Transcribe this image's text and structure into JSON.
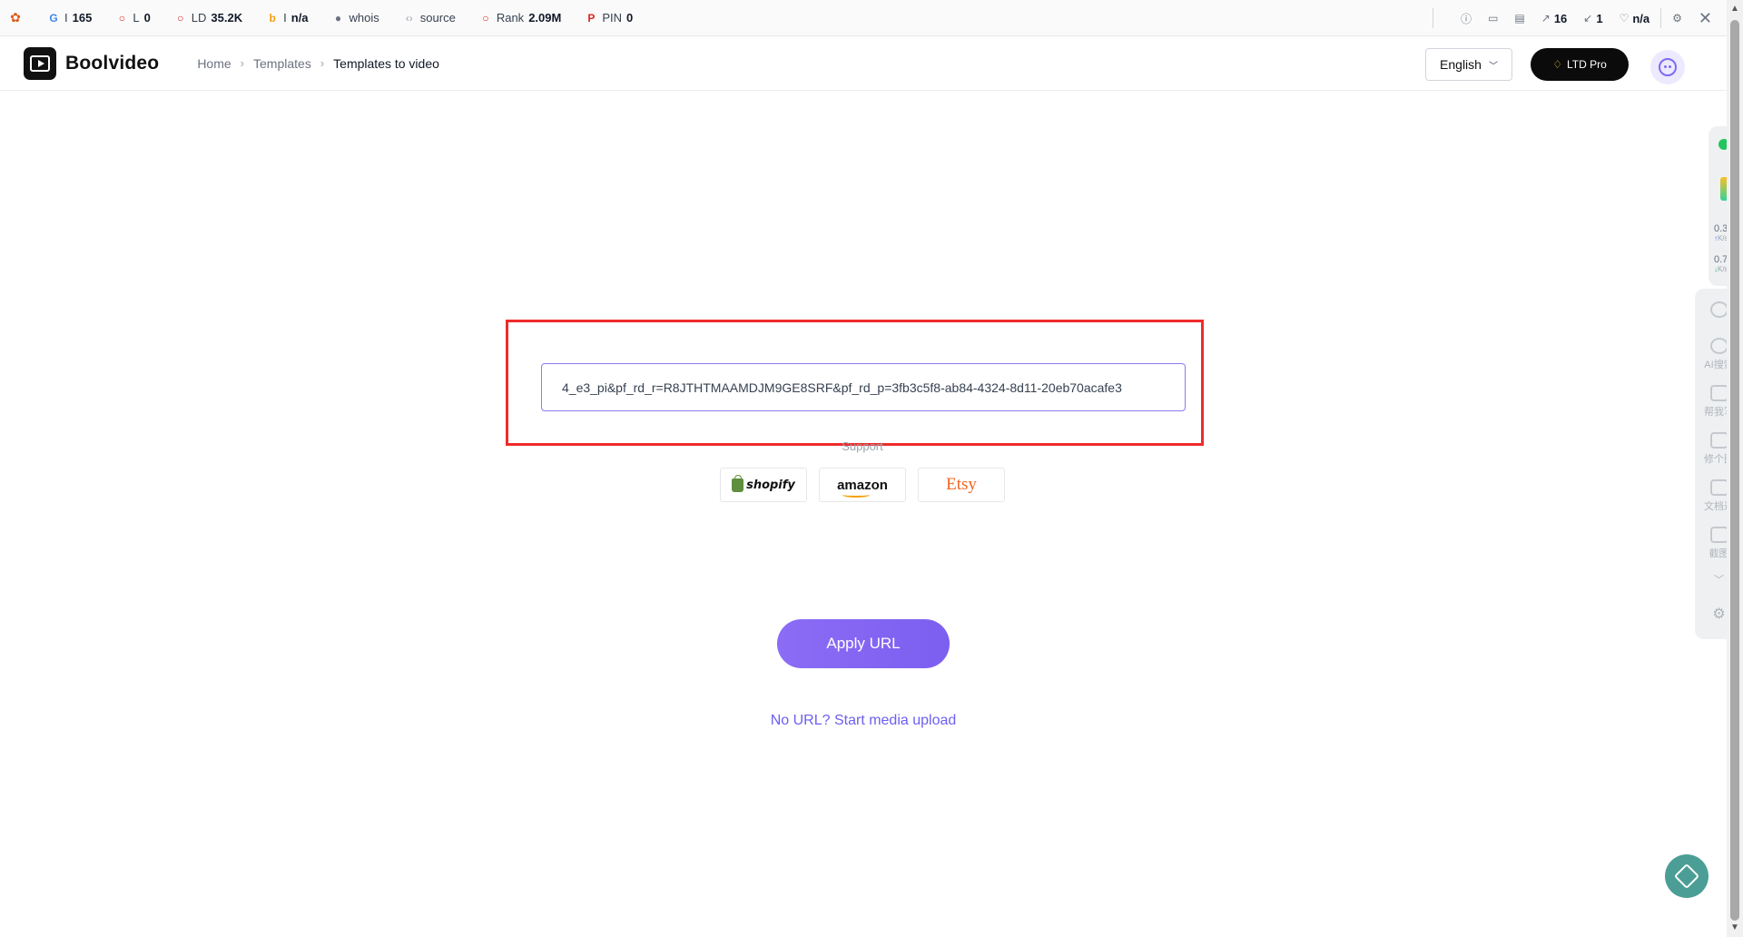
{
  "seo_toolbar": {
    "items": [
      {
        "icon": "google-icon",
        "prefix": "I",
        "value": "165"
      },
      {
        "icon": "circle-icon",
        "prefix": "L",
        "value": "0"
      },
      {
        "icon": "circle-icon",
        "prefix": "LD",
        "value": "35.2K"
      },
      {
        "icon": "bing-icon",
        "prefix": "I",
        "value": "n/a"
      },
      {
        "icon": "person-icon",
        "prefix": "whois",
        "value": ""
      },
      {
        "icon": "code-icon",
        "prefix": "source",
        "value": ""
      },
      {
        "icon": "circle-icon",
        "prefix": "Rank",
        "value": "2.09M"
      },
      {
        "icon": "pinterest-icon",
        "prefix": "PIN",
        "value": "0"
      }
    ],
    "right": [
      {
        "icon": "info-icon",
        "value": ""
      },
      {
        "icon": "monitor-icon",
        "value": ""
      },
      {
        "icon": "page-icon",
        "value": ""
      },
      {
        "icon": "external-link-icon",
        "value": "16"
      },
      {
        "icon": "internal-link-icon",
        "value": "1"
      },
      {
        "icon": "heart-icon",
        "value": "n/a"
      }
    ]
  },
  "header": {
    "brand": "Boolvideo",
    "breadcrumb": [
      "Home",
      "Templates",
      "Templates to video"
    ],
    "language": "English",
    "pro_label": "LTD Pro"
  },
  "main": {
    "url_value": "4_e3_pi&pf_rd_r=R8JTHTMAAMDJM9GE8SRF&pf_rd_p=3fb3c5f8-ab84-4324-8d11-20eb70acafe3",
    "support_label": "Support",
    "platforms": [
      "shopify",
      "amazon",
      "Etsy"
    ],
    "apply_label": "Apply URL",
    "upload_link": "No URL? Start media upload"
  },
  "side_panel": {
    "upload_speed": "0.3",
    "download_speed": "0.7",
    "speed_unit": "K/s",
    "tools": [
      "AI搜索",
      "帮我写",
      "修个图",
      "文档通",
      "截图"
    ]
  },
  "colors": {
    "accent": "#7c5ff0",
    "highlight": "#ef2b2b",
    "etsy": "#f1641e",
    "shopify": "#5e8e3e",
    "help": "#4b9e95"
  }
}
